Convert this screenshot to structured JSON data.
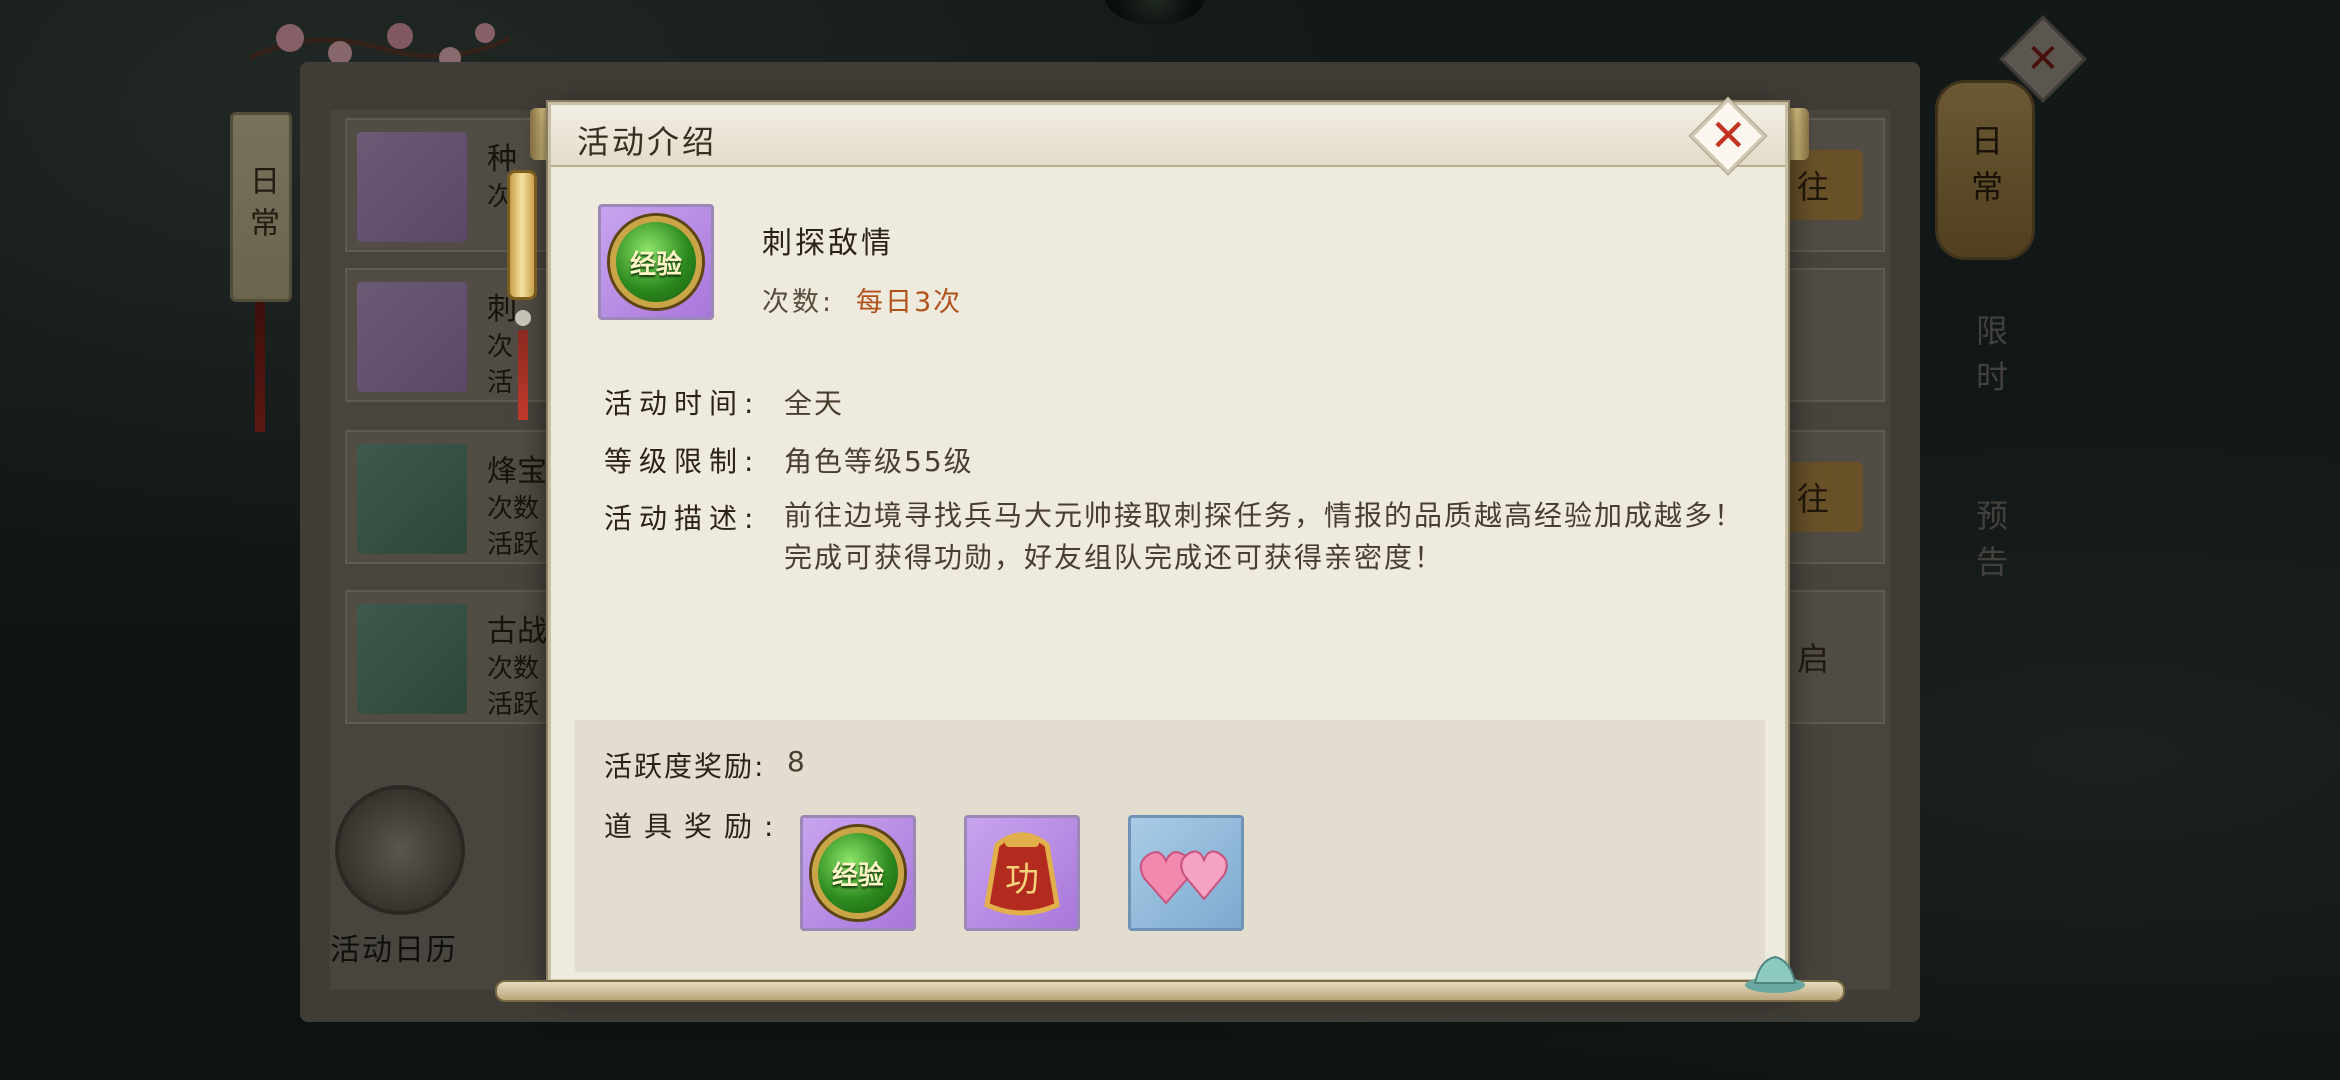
{
  "background": {
    "side_tab_label": "日常",
    "rows": [
      {
        "title": "种",
        "line2": "次",
        "line3": "",
        "button": "往"
      },
      {
        "title": "刺",
        "line2": "次",
        "line3": "活",
        "button": ""
      },
      {
        "title": "烽宝",
        "line2": "次数",
        "line3": "活跃",
        "button": "往"
      },
      {
        "title": "古战",
        "line2": "次数",
        "line3": "活跃",
        "button": "启"
      }
    ],
    "calendar_label": "活动日历",
    "right_tabs": {
      "daily": "日常",
      "limited": "限时",
      "preview": "预告"
    }
  },
  "modal": {
    "title": "活动介绍",
    "activity_name": "刺探敌情",
    "count_label": "次数:",
    "count_value": "每日3次",
    "icon_text": "经验",
    "info": {
      "time_label": "活动时间:",
      "time_value": "全天",
      "level_label": "等级限制:",
      "level_value": "角色等级55级",
      "desc_label": "活动描述:",
      "desc_value": "前往边境寻找兵马大元帅接取刺探任务，情报的品质越高经验加成越多！完成可获得功勋，好友组队完成还可获得亲密度！"
    },
    "rewards": {
      "activity_label": "活跃度奖励:",
      "activity_value": "8",
      "items_label": "道具奖励:",
      "items": [
        {
          "icon": "exp-orb-icon",
          "text": "经验"
        },
        {
          "icon": "merit-pouch-icon",
          "text": "功"
        },
        {
          "icon": "hearts-icon",
          "text": ""
        }
      ]
    }
  }
}
